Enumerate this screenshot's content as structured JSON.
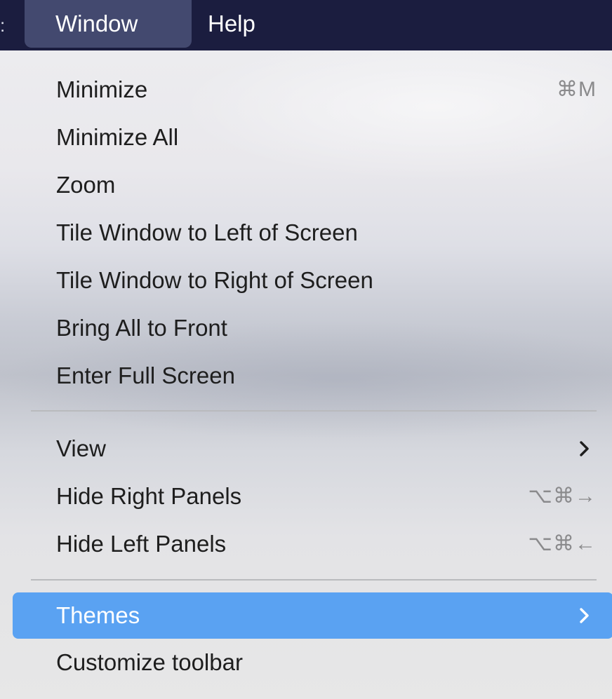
{
  "menubar": {
    "edge_glyph": ":",
    "items": [
      {
        "label": "Window",
        "active": true
      },
      {
        "label": "Help",
        "active": false
      }
    ]
  },
  "menu": {
    "items": [
      {
        "label": "Minimize",
        "shortcut": "⌘M"
      },
      {
        "label": "Minimize All",
        "shortcut": ""
      },
      {
        "label": "Zoom",
        "shortcut": ""
      },
      {
        "label": "Tile Window to Left of Screen",
        "shortcut": ""
      },
      {
        "label": "Tile Window to Right of Screen",
        "shortcut": ""
      },
      {
        "label": "Bring All to Front",
        "shortcut": ""
      },
      {
        "label": "Enter Full Screen",
        "shortcut": ""
      },
      {
        "label": "View",
        "submenu": true
      },
      {
        "label": "Hide Right Panels",
        "shortcut": "⌥⌘→"
      },
      {
        "label": "Hide Left Panels",
        "shortcut": "⌥⌘←"
      },
      {
        "label": "Themes",
        "submenu": true,
        "highlighted": true
      },
      {
        "label": "Customize toolbar",
        "shortcut": ""
      }
    ]
  },
  "colors": {
    "menubar_bg": "#1b1d3f",
    "highlight": "#5aa2f2",
    "shortcut_text": "#8a8a8c",
    "label_text": "#1e1e1e"
  },
  "icons": {
    "submenu": "chevron-right-icon"
  }
}
